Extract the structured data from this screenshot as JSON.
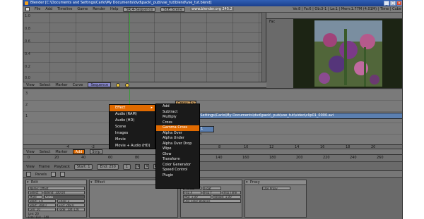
{
  "window": {
    "title": "Blender [C:\\Documents and Settings\\Carlo\\My Documents\\dvd\\pack\\_pub\\vse_tut\\blend\\vse_tut.blend]",
    "buttons": [
      "_",
      "□",
      "×"
    ]
  },
  "menubar": {
    "items": [
      "File",
      "Add",
      "Timeline",
      "Game",
      "Render",
      "Help"
    ],
    "screen": "SR:4-Sequence",
    "scene": "SCE:Scene",
    "url": "www.blender.org 245.2",
    "stats": "Ve:8 | Fa:6 | Ob:3-1 | La:1 | Mem:1.77M (4.01M) | Time | Cube"
  },
  "graph": {
    "y_labels": [
      "1.0",
      "0.8",
      "0.6",
      "0.4",
      "0.2",
      "0.0"
    ],
    "header": [
      "View",
      "Select",
      "Marker",
      "Curve"
    ],
    "sequence_field": "Sequence"
  },
  "preview": {
    "label": "Fac"
  },
  "sequencer": {
    "row_labels": [
      "3",
      "2",
      "1"
    ],
    "cross_strip": "Cross: 1>2",
    "movie_strip": "608 | C:\\Documents and Settings\\Carlo\\My Documents\\dvd\\pack\\_pub\\vse_tut\\video\\clip01_0000.avi",
    "movie_strip2": "Movie: 1",
    "note": "selection",
    "ruler": [
      "-4",
      "-2",
      "0",
      "2",
      "4",
      "6",
      "8",
      "10",
      "12",
      "14",
      "16",
      "18",
      "20"
    ],
    "header": [
      "View",
      "Select",
      "Marker"
    ],
    "add_label": "Add",
    "strip_label": "Strip"
  },
  "timeline": {
    "ticks": [
      "0",
      "20",
      "40",
      "60",
      "80",
      "100",
      "120",
      "140",
      "160",
      "180",
      "200",
      "220",
      "240",
      "260"
    ],
    "menus": [
      "View",
      "Frame",
      "Playback"
    ],
    "start": "Start: 1",
    "end": "End: 250",
    "current": "1"
  },
  "buttons_header": {
    "panels_label": "Panels"
  },
  "panels": {
    "edit": {
      "title": "Edit",
      "fields": [
        "Name: Offset",
        "Select",
        "Blend: 100.00",
        "Mute",
        "Cross",
        "Start: 1.0",
        "Chan: 2",
        "Start: 208.0",
        "End: 208.0",
        "Len: 20",
        "Fade: 104-126"
      ],
      "footer": [
        "Len: 20",
        "Frm: 114 - 140"
      ]
    },
    "effect": {
      "title": "Effect"
    },
    "filter": {
      "title": "Filter",
      "fields": [
        "Premul",
        "Float",
        "Flip X",
        "Flip Y",
        "Flip Time",
        "Mul: 1.00",
        "Strobe: 1.00",
        "Use Color Balance"
      ]
    },
    "proxy": {
      "title": "Proxy",
      "fields": [
        "Use Proxy"
      ]
    }
  },
  "add_menu": {
    "header": "Effect",
    "arrow": "▸",
    "items": [
      "Audio (RAM)",
      "Audio (HD)",
      "Scene",
      "Images",
      "Movie",
      "Movie + Audio (HD)"
    ]
  },
  "effect_menu": {
    "items": [
      "Add",
      "Subtract",
      "Multiply",
      "Cross",
      "Gamma Cross",
      "Alpha Over",
      "Alpha Under",
      "Alpha Over Drop",
      "Wipe",
      "Glow",
      "Transform",
      "Color Generator",
      "Speed Control",
      "Plugin"
    ],
    "selected_index": 4
  },
  "colors": {
    "accent": "#e06a00",
    "title_bar": "#2f5fb5",
    "strip_blue": "#5b7fb0",
    "cross_strip": "#c79b60"
  }
}
